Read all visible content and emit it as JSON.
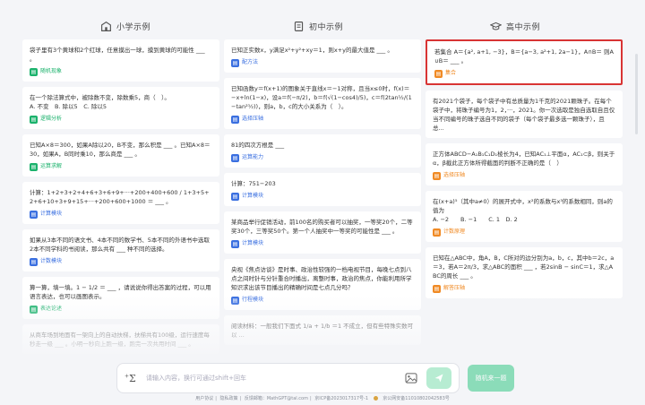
{
  "columns": [
    {
      "title": "小学示例",
      "icon": "primary-school-icon"
    },
    {
      "title": "初中示例",
      "icon": "middle-school-icon"
    },
    {
      "title": "高中示例",
      "icon": "high-school-icon"
    }
  ],
  "primary": [
    {
      "q": "袋子里有3个黄球和2个红球，任意摸出一球，摸到黄球的可能性 ___ 。",
      "tag": "随机现象",
      "color": "green"
    },
    {
      "q": "在一个除法算式中，被除数不变，除数乘5，商（　）。",
      "q2": "A. 不变　B. 除以5　C. 除以5",
      "tag": "逻辑分析",
      "color": "green"
    },
    {
      "q": "已知A×8＝300，如果A除以20，B不变，那么积是 ___ 。已知A×8＝30，如果A，B同时乘10，那么商是 ___ 。",
      "tag": "运算求解",
      "color": "green"
    },
    {
      "q": "计算：1+2+3+2+4+6+3+6+9+···+200+400+600 / 1+3+5+2+6+10+3+9+15+···+200+600+1000 ＝ ___ 。",
      "tag": "计算模块",
      "color": "blue"
    },
    {
      "q": "如果从3本不同的语文书、4本不同的数学书、5本不同的外语书中选取2本不同学科的书阅读，那么共有 ___ 种不同的选择。",
      "tag": "计数模块",
      "color": "blue"
    },
    {
      "q": "算一算，填一填。1 − 1/2 ＝ ___ ，请说说你得出答案的过程，可以用语言表达，也可以画图表示。",
      "tag": "表达论述",
      "color": "green"
    },
    {
      "q": "从商车场到地面有一架向上的自动扶梯，扶梯共有100级，运行速度每秒走一级 ___ 。小明一秒向上跑一级，跑完一次共用时间 ___ 。",
      "tag": "",
      "color": "green"
    }
  ],
  "middle": [
    {
      "q": "已知正实数x，y满足x²+y²+xy＝1，则x+y的最大值是 ___ 。",
      "tag": "配方法",
      "color": "blue"
    },
    {
      "q": "已知函数y＝f(x+1)的图象关于直线x＝−1对称，且当x≤0时，f(x)＝−x+ln(1−x)，设a＝f(−π/2)，b＝f(√(1−cos4)/5)，c＝f(2tan½/(1−tan²½))，则a，b，c的大小关系为（　）。",
      "tag": "选择压轴",
      "color": "blue"
    },
    {
      "q": "81的四次方根是 ___",
      "tag": "运算能力",
      "color": "blue"
    },
    {
      "q": "计算：751−203",
      "tag": "计算模块",
      "color": "blue"
    },
    {
      "q": "某商品举行促销活动，前100名的购买者可以抽奖，一等奖20个，二等奖30个，三等奖50个。第一个人抽奖中一等奖的可能性是 ___ 。",
      "tag": "计算模块",
      "color": "blue"
    },
    {
      "q": "央视《焦点访谈》是时事、政治性较强的一档电视节目，每晚七点到八点之间时针与分针重合时播出，离整时事，政治的焦点，你能利用所学知识求出该节目播出的精确时间是七点几分吗？",
      "tag": "行程模块",
      "color": "blue"
    },
    {
      "q": "阅读材料：一般我们下面式 1/a + 1/b ＝1 不成立，但有些特殊实数可以 ...",
      "tag": "",
      "color": "blue"
    }
  ],
  "high": [
    {
      "q": "若集合 A＝{a², a+1, −3}，B＝{a−3, a²+1, 2a−1}，A∩B＝ 则A∪B＝ ___ 。",
      "tag": "集合",
      "color": "orange",
      "highlight": true
    },
    {
      "q": "有2021个袋子，每个袋子中有总质量为1千克的2021颗珠子。在每个袋子中，将珠子编号为1，2，···，2021。你一次选取是独自选取自且仅当不同编号的珠子选自不同的袋子（每个袋子最多选一颗珠子），且总...",
      "tag": "",
      "color": "orange"
    },
    {
      "q": "正方体ABCD−A₁B₁C₁D₁棱长为4，已知AC₁⊥平面α，AC₁⊂β，则关于α，β截此正方体所得截面的判断不正确的是（　）",
      "tag": "选择压轴",
      "color": "orange"
    },
    {
      "q": "在(x+a)⁵（其中a≠0）的展开式中，x²的系数与x³的系数相同，则a的值为",
      "q2": "A. −2　　B. −1　　C. 1　D. 2",
      "tag": "计数原理",
      "color": "orange"
    },
    {
      "q": "已知在△ABC中，角A，B，C所对的边分别为a，b，c，其中b＝2c，a＝3，若A＝2π/3，求△ABC的面积 ___ ，若2sinB − sinC＝1，求△ABC的周长 ___ 。",
      "tag": "解答压轴",
      "color": "orange"
    }
  ],
  "input": {
    "placeholder": "请输入内容，换行可通过shift+回车",
    "sigma": "Σ"
  },
  "random_button": "随机来一题",
  "footer": [
    "用户协议",
    "隐私政策",
    "反馈邮箱：MathGPT@tal.com",
    "京ICP备2023017317号-1",
    "京公网安备11010802042583号"
  ]
}
